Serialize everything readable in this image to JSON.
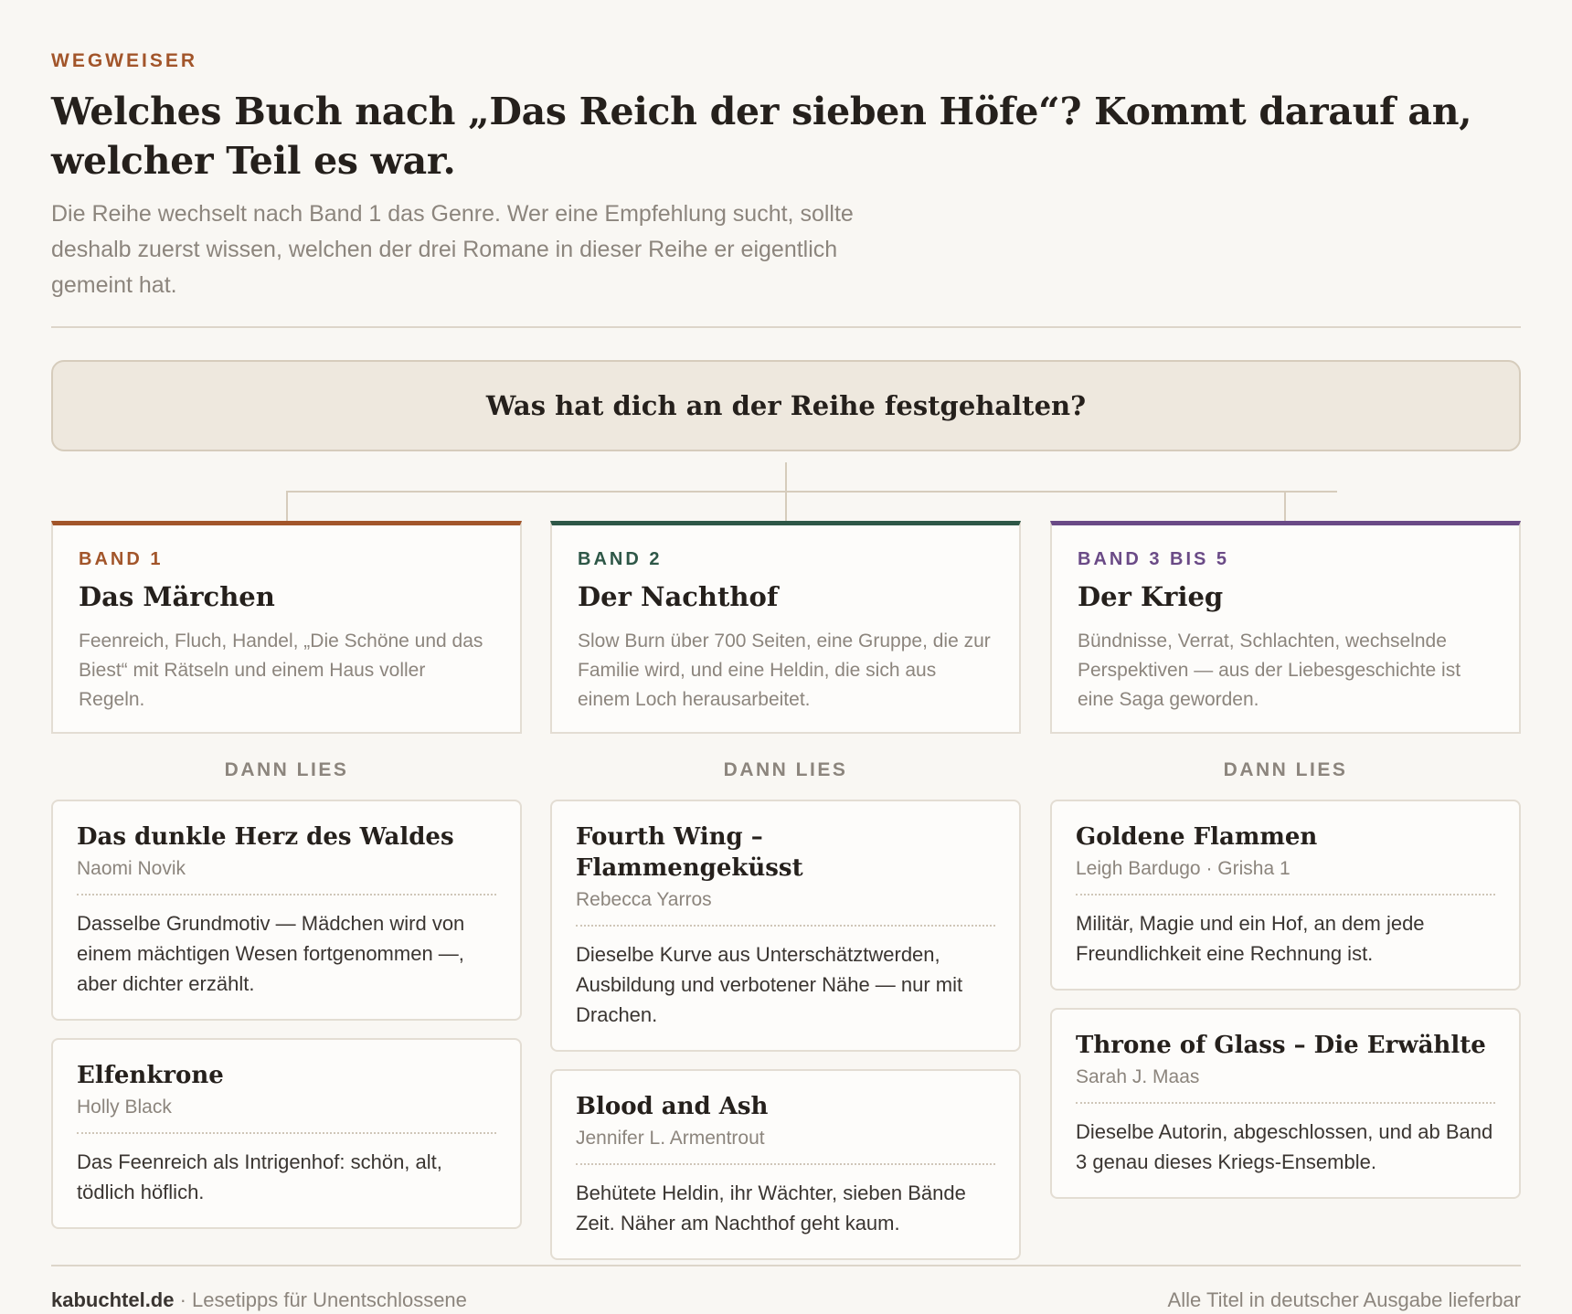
{
  "header": {
    "eyebrow": "WEGWEISER",
    "title": "Welches Buch nach „Das Reich der sieben Höfe“? Kommt darauf an, welcher Teil es war.",
    "subtitle": "Die Reihe wechselt nach Band 1 das Genre. Wer eine Empfehlung sucht, sollte deshalb zuerst wissen, welchen der drei Romane in dieser Reihe er eigentlich gemeint hat."
  },
  "question": "Was hat dich an der Reihe festgehalten?",
  "then_label": "DANN LIES",
  "columns": [
    {
      "band_label": "BAND 1",
      "band_name": "Das Märchen",
      "band_desc": "Feenreich, Fluch, Handel, „Die Schöne und das Biest“ mit Rätseln und einem Haus voller Regeln.",
      "accent_color": "#a2552a",
      "books": [
        {
          "title": "Das dunkle Herz des Waldes",
          "author": "Naomi Novik",
          "why": "Dasselbe Grundmotiv — Mädchen wird von einem mächtigen Wesen fortgenommen —, aber dichter erzählt."
        },
        {
          "title": "Elfenkrone",
          "author": "Holly Black",
          "why": "Das Feenreich als Intrigenhof: schön, alt, tödlich höflich."
        }
      ]
    },
    {
      "band_label": "BAND 2",
      "band_name": "Der Nachthof",
      "band_desc": "Slow Burn über 700 Seiten, eine Gruppe, die zur Familie wird, und eine Heldin, die sich aus einem Loch herausarbeitet.",
      "accent_color": "#2e5747",
      "books": [
        {
          "title": "Fourth Wing – Flammengeküsst",
          "author": "Rebecca Yarros",
          "why": "Dieselbe Kurve aus Unterschätztwerden, Ausbildung und verbotener Nähe — nur mit Drachen."
        },
        {
          "title": "Blood and Ash",
          "author": "Jennifer L. Armentrout",
          "why": "Behütete Heldin, ihr Wächter, sieben Bände Zeit. Näher am Nachthof geht kaum."
        }
      ]
    },
    {
      "band_label": "BAND 3 BIS 5",
      "band_name": "Der Krieg",
      "band_desc": "Bündnisse, Verrat, Schlachten, wechselnde Perspektiven — aus der Liebesgeschichte ist eine Saga geworden.",
      "accent_color": "#6a4a86",
      "books": [
        {
          "title": "Goldene Flammen",
          "author": "Leigh Bardugo · Grisha 1",
          "why": "Militär, Magie und ein Hof, an dem jede Freundlichkeit eine Rechnung ist."
        },
        {
          "title": "Throne of Glass – Die Erwählte",
          "author": "Sarah J. Maas",
          "why": "Dieselbe Autorin, abgeschlossen, und ab Band 3 genau dieses Kriegs-Ensemble."
        }
      ]
    }
  ],
  "footer": {
    "site": "kabuchtel.de",
    "tagline": "· Lesetipps für Unentschlossene",
    "note": "Alle Titel in deutscher Ausgabe lieferbar"
  }
}
